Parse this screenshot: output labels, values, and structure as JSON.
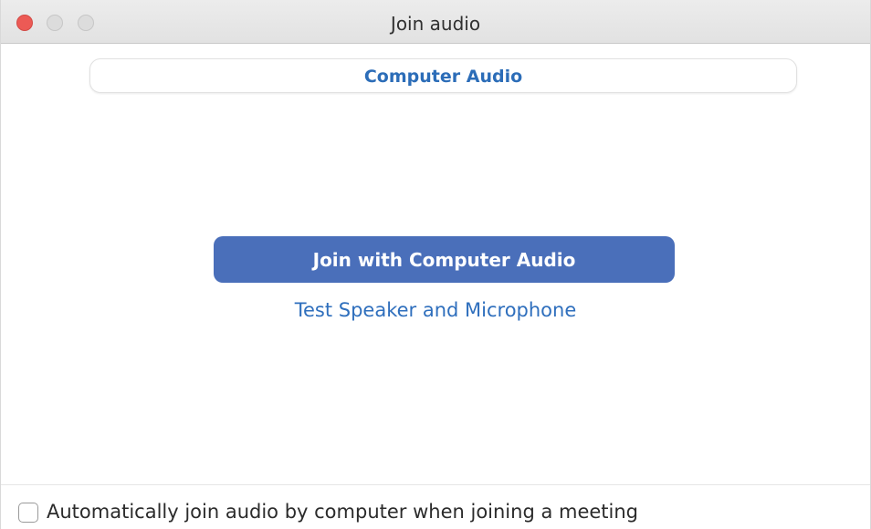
{
  "window": {
    "title": "Join audio"
  },
  "tabs": [
    {
      "label": "Computer Audio",
      "selected": true
    }
  ],
  "main": {
    "join_button_label": "Join with Computer Audio",
    "test_link_label": "Test Speaker and Microphone"
  },
  "footer": {
    "auto_join_label": "Automatically join audio by computer when joining a meeting",
    "auto_join_checked": false
  },
  "colors": {
    "accent": "#4a6fba",
    "link": "#2f6fbd",
    "close": "#ec5a55"
  },
  "icons": {
    "close": "close-window-icon",
    "minimize": "minimize-window-icon",
    "maximize": "maximize-window-icon"
  }
}
